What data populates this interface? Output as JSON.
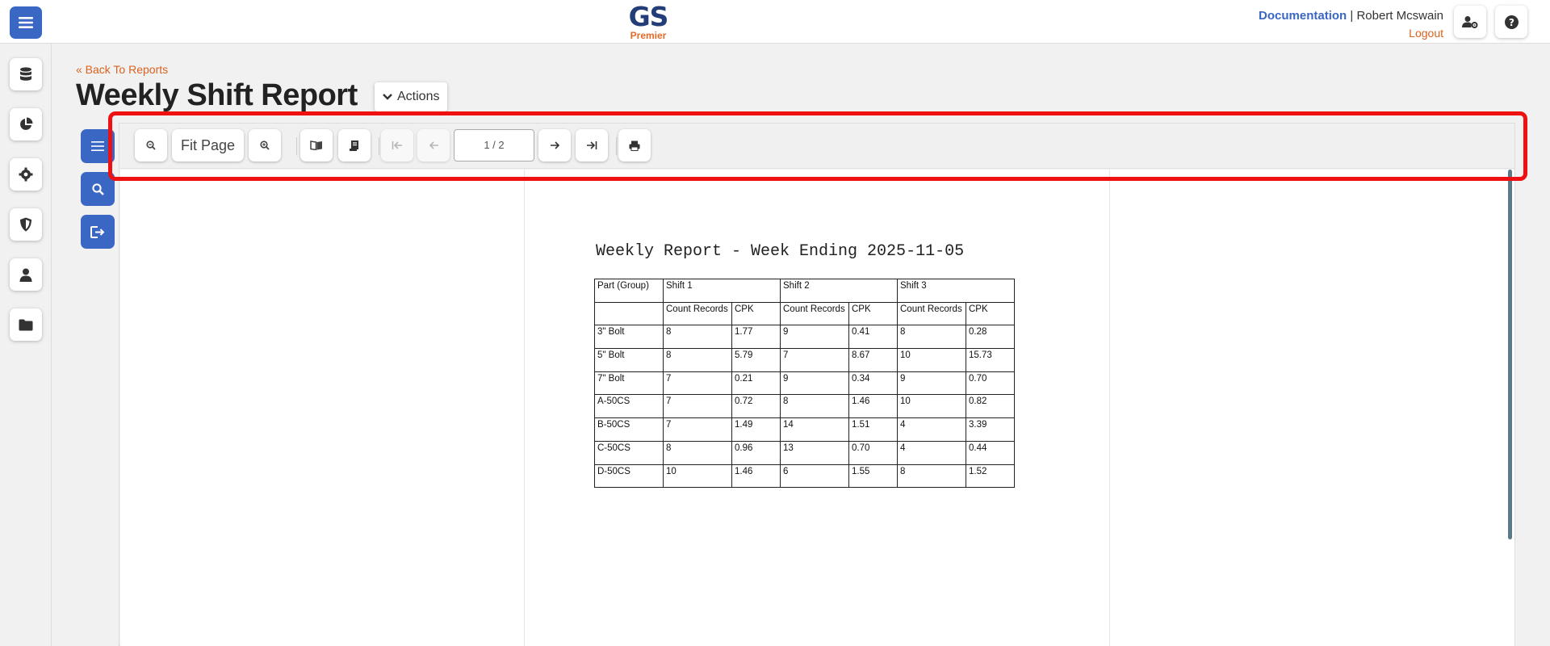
{
  "brand": {
    "logo_main": "GS",
    "logo_sub": "Premier"
  },
  "topbar": {
    "documentation": "Documentation",
    "separator": "|",
    "user_name": "Robert Mcswain",
    "logout": "Logout"
  },
  "header": {
    "back_link": "« Back To Reports",
    "title": "Weekly Shift Report",
    "actions_label": "Actions"
  },
  "toolbar": {
    "fit_page": "Fit Page",
    "page_indicator": "1 / 2"
  },
  "report": {
    "title": "Weekly Report - Week Ending 2025-11-05",
    "header_part": "Part (Group)",
    "shifts": [
      "Shift 1",
      "Shift 2",
      "Shift 3"
    ],
    "sub_count": "Count Records",
    "sub_cpk": "CPK",
    "rows": [
      [
        "3\" Bolt",
        "8",
        "1.77",
        "9",
        "0.41",
        "8",
        "0.28"
      ],
      [
        "5\" Bolt",
        "8",
        "5.79",
        "7",
        "8.67",
        "10",
        "15.73"
      ],
      [
        "7\" Bolt",
        "7",
        "0.21",
        "9",
        "0.34",
        "9",
        "0.70"
      ],
      [
        "A-50CS",
        "7",
        "0.72",
        "8",
        "1.46",
        "10",
        "0.82"
      ],
      [
        "B-50CS",
        "7",
        "1.49",
        "14",
        "1.51",
        "4",
        "3.39"
      ],
      [
        "C-50CS",
        "8",
        "0.96",
        "13",
        "0.70",
        "4",
        "0.44"
      ],
      [
        "D-50CS",
        "10",
        "1.46",
        "6",
        "1.55",
        "8",
        "1.52"
      ]
    ]
  },
  "colors": {
    "primary": "#3a66c4",
    "accent": "#d8621e",
    "highlight": "#ef1111"
  }
}
